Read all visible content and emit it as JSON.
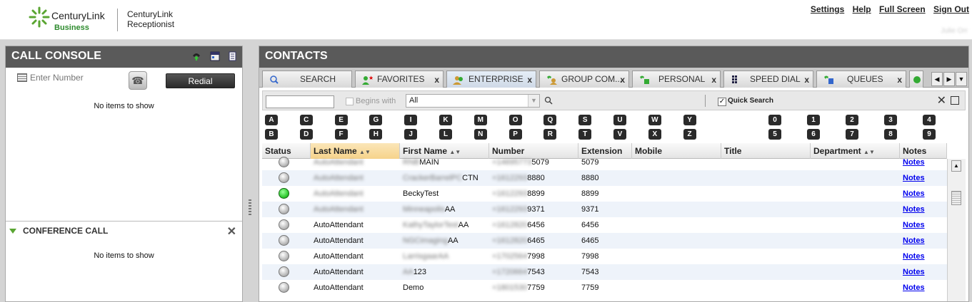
{
  "header": {
    "brand_name": "CenturyLink",
    "brand_sub": "Business",
    "product": "CenturyLink Receptionist",
    "links": [
      "Settings",
      "Help",
      "Full Screen",
      "Sign Out"
    ],
    "username": "Julie Orr"
  },
  "call_console": {
    "title": "CALL CONSOLE",
    "number_placeholder": "Enter Number",
    "redial_label": "Redial",
    "empty_text": "No items to show"
  },
  "conference_call": {
    "title": "CONFERENCE CALL",
    "empty_text": "No items to show"
  },
  "contacts": {
    "title": "CONTACTS",
    "tabs": [
      {
        "label": "SEARCH",
        "closable": false,
        "icon": "search-icon"
      },
      {
        "label": "FAVORITES",
        "closable": true,
        "icon": "favorites-icon"
      },
      {
        "label": "ENTERPRISE",
        "closable": true,
        "icon": "enterprise-icon",
        "active": true
      },
      {
        "label": "GROUP COM...",
        "closable": true,
        "icon": "group-icon"
      },
      {
        "label": "PERSONAL",
        "closable": true,
        "icon": "personal-icon"
      },
      {
        "label": "SPEED DIAL",
        "closable": true,
        "icon": "speed-dial-icon"
      },
      {
        "label": "QUEUES",
        "closable": true,
        "icon": "queues-icon"
      }
    ],
    "search": {
      "query": "",
      "begins_with_label": "Begins with",
      "scope_value": "All",
      "quick_search_label": "Quick Search",
      "quick_search_checked": true
    },
    "letters": [
      "A",
      "B",
      "C",
      "D",
      "E",
      "F",
      "G",
      "H",
      "I",
      "J",
      "K",
      "L",
      "M",
      "N",
      "O",
      "P",
      "Q",
      "R",
      "S",
      "T",
      "U",
      "V",
      "W",
      "X",
      "Y",
      "Z"
    ],
    "digits": [
      "0",
      "1",
      "2",
      "3",
      "4",
      "5",
      "6",
      "7",
      "8",
      "9"
    ],
    "columns": [
      "Status",
      "Last Name",
      "First Name",
      "Number",
      "Extension",
      "Mobile",
      "Title",
      "Department",
      "Notes"
    ],
    "rows": [
      {
        "status": "idle",
        "last": "AutoAttendant",
        "last_blur": true,
        "first_prefix": "RNB",
        "first_suffix": "MAIN",
        "num_prefix": "+14695773",
        "num_suffix": "5079",
        "ext": "5079",
        "notes": "Notes"
      },
      {
        "status": "idle",
        "last": "AutoAttendant",
        "last_blur": true,
        "first_prefix": "CrackerBarrelPC",
        "first_suffix": "CTN",
        "num_prefix": "+1612293",
        "num_suffix": "8880",
        "ext": "8880",
        "notes": "Notes"
      },
      {
        "status": "busy",
        "last": "AutoAttendant",
        "last_blur": true,
        "first_prefix": "",
        "first_suffix": "BeckyTest",
        "num_prefix": "+1612293",
        "num_suffix": "8899",
        "ext": "8899",
        "notes": "Notes"
      },
      {
        "status": "idle",
        "last": "AutoAttendant",
        "last_blur": true,
        "first_prefix": "Minneapolis",
        "first_suffix": "AA",
        "num_prefix": "+1612293",
        "num_suffix": "9371",
        "ext": "9371",
        "notes": "Notes"
      },
      {
        "status": "idle",
        "last": "AutoAttendant",
        "last_blur": false,
        "first_prefix": "KathyTaylorTest",
        "first_suffix": "AA",
        "num_prefix": "+1612820",
        "num_suffix": "6456",
        "ext": "6456",
        "notes": "Notes"
      },
      {
        "status": "idle",
        "last": "AutoAttendant",
        "last_blur": false,
        "first_prefix": "NGCimaging",
        "first_suffix": "AA",
        "num_prefix": "+1612820",
        "num_suffix": "6465",
        "ext": "6465",
        "notes": "Notes"
      },
      {
        "status": "idle",
        "last": "AutoAttendant",
        "last_blur": false,
        "first_prefix": "LarrisgaarAA",
        "first_suffix": "",
        "num_prefix": "+1702564",
        "num_suffix": "7998",
        "ext": "7998",
        "notes": "Notes"
      },
      {
        "status": "idle",
        "last": "AutoAttendant",
        "last_blur": false,
        "first_prefix": "AA",
        "first_suffix": "123",
        "num_prefix": "+1720664",
        "num_suffix": "7543",
        "ext": "7543",
        "notes": "Notes"
      },
      {
        "status": "idle",
        "last": "AutoAttendant",
        "last_blur": false,
        "first_prefix": "",
        "first_suffix": "Demo",
        "num_prefix": "+1801530",
        "num_suffix": "7759",
        "ext": "7759",
        "notes": "Notes"
      }
    ]
  },
  "colors": {
    "panel_header": "#5a5a5a",
    "brand_green": "#5aa532",
    "link": "#0000ee",
    "sorted_header": "#f6d38b"
  }
}
